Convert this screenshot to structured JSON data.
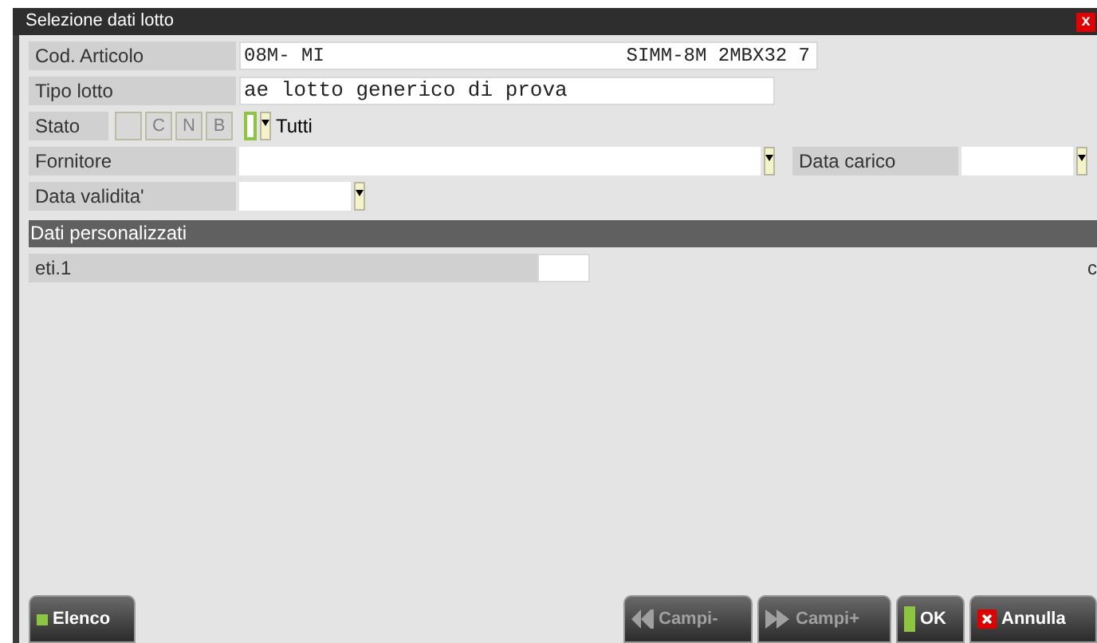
{
  "window": {
    "title": "Selezione dati lotto",
    "close": "x"
  },
  "cod_articolo": {
    "label": "Cod. Articolo",
    "code": "08M- MI",
    "description": "SIMM-8M 2MBX32 7"
  },
  "tipo_lotto": {
    "label": "Tipo lotto",
    "value": "ae lotto generico di prova"
  },
  "stato": {
    "label": "Stato",
    "toggles": [
      {
        "disabled": true
      },
      {
        "label": "C",
        "disabled": true
      },
      {
        "label": "N",
        "disabled": true
      },
      {
        "label": "B",
        "disabled": true
      }
    ],
    "checked": false,
    "option": "Tutti"
  },
  "fornitore": {
    "label": "Fornitore"
  },
  "data_carico": {
    "label": "Data carico"
  },
  "data_validita": {
    "label": "Data validita'"
  },
  "section": {
    "title": "Dati personalizzati",
    "fields": [
      {
        "label": "eti.1",
        "suffix": "c"
      }
    ]
  },
  "buttons": [
    {
      "kind": "marker",
      "label": "Elenco",
      "disabled": false
    },
    {
      "kind": "prev",
      "label": "Campi-",
      "disabled": true
    },
    {
      "kind": "next",
      "label": "Campi+",
      "disabled": true
    },
    {
      "kind": "ok",
      "label": "OK",
      "disabled": false
    },
    {
      "kind": "cancel",
      "label": "Annulla",
      "disabled": false
    }
  ]
}
